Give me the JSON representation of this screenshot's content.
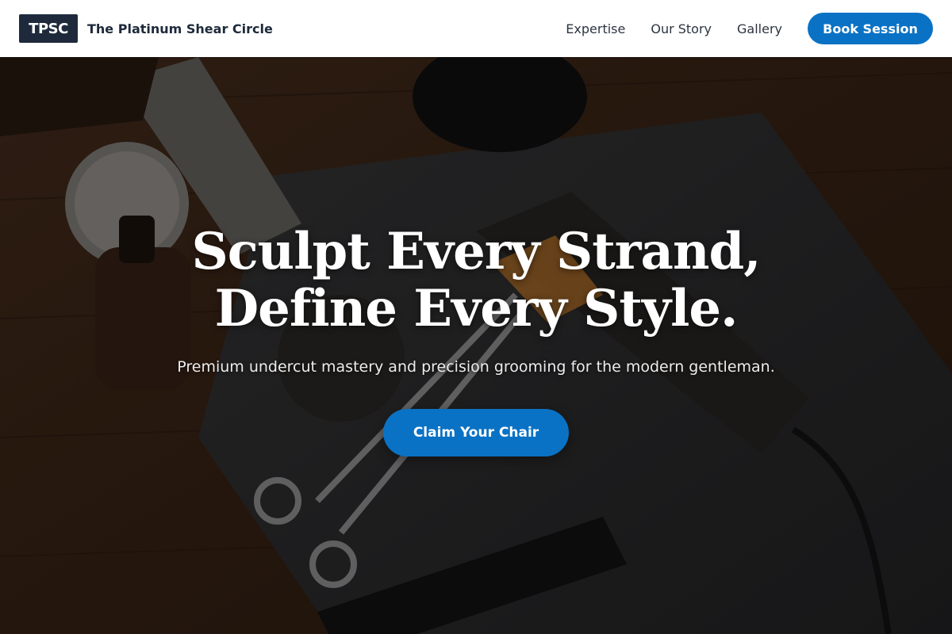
{
  "header": {
    "logo_text": "TPSC",
    "brand_name": "The Platinum Shear Circle",
    "nav": [
      {
        "label": "Expertise"
      },
      {
        "label": "Our Story"
      },
      {
        "label": "Gallery"
      }
    ],
    "cta_label": "Book Session"
  },
  "hero": {
    "title_line1": "Sculpt Every Strand,",
    "title_line2": "Define Every Style.",
    "subtitle": "Premium undercut mastery and precision grooming for the modern gentleman.",
    "cta_label": "Claim Your Chair",
    "background_image": "barber-tools-photo"
  },
  "colors": {
    "accent": "#0a72c4",
    "logo_bg": "#1e2a3b",
    "header_bg": "#ffffff",
    "hero_text": "#ffffff"
  }
}
